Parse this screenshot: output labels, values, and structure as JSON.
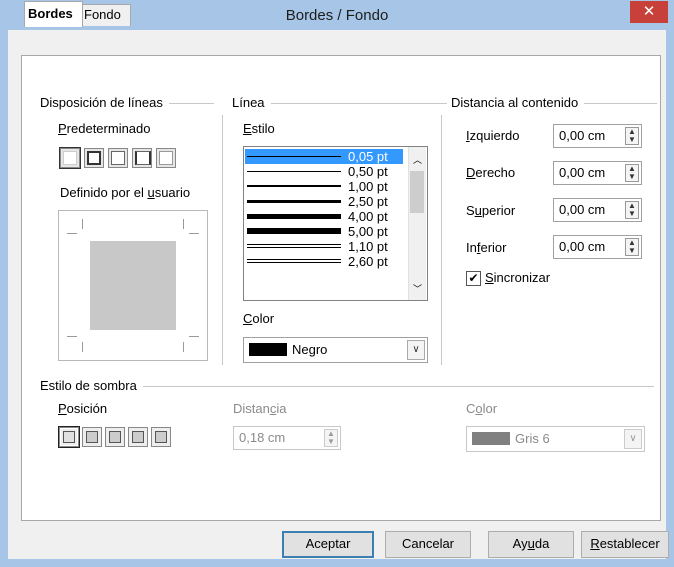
{
  "window": {
    "title": "Bordes / Fondo",
    "close_glyph": "✕"
  },
  "tabs": [
    {
      "label": "Bordes"
    },
    {
      "label": "Fondo"
    }
  ],
  "line_arrangement": {
    "group_title": "Disposición de líneas",
    "default_label": "Predeterminado",
    "user_defined_label": "Definido por el usuario",
    "preset_count": 5
  },
  "line": {
    "group_title": "Línea",
    "style_label": "Estilo",
    "styles": [
      {
        "label": "0,05 pt",
        "thickness": 1,
        "double": false,
        "selected": true
      },
      {
        "label": "0,50 pt",
        "thickness": 1,
        "double": false,
        "selected": false
      },
      {
        "label": "1,00 pt",
        "thickness": 2,
        "double": false,
        "selected": false
      },
      {
        "label": "2,50 pt",
        "thickness": 3,
        "double": false,
        "selected": false
      },
      {
        "label": "4,00 pt",
        "thickness": 5,
        "double": false,
        "selected": false
      },
      {
        "label": "5,00 pt",
        "thickness": 6,
        "double": false,
        "selected": false
      },
      {
        "label": "1,10 pt",
        "thickness": 1,
        "double": true,
        "selected": false
      },
      {
        "label": "2,60 pt",
        "thickness": 1,
        "double": true,
        "selected": false
      }
    ],
    "color_label": "Color",
    "color_value": "Negro",
    "color_swatch": "#000000"
  },
  "spacing": {
    "group_title": "Distancia al contenido",
    "fields": [
      {
        "label": "Izquierdo",
        "value": "0,00 cm"
      },
      {
        "label": "Derecho",
        "value": "0,00 cm"
      },
      {
        "label": "Superior",
        "value": "0,00 cm"
      },
      {
        "label": "Inferior",
        "value": "0,00 cm"
      }
    ],
    "sync_label": "Sincronizar",
    "sync_checked": true
  },
  "shadow": {
    "group_title": "Estilo de sombra",
    "position_label": "Posición",
    "distance_label": "Distancia",
    "distance_value": "0,18 cm",
    "color_label": "Color",
    "color_value": "Gris 6",
    "color_swatch": "#808080"
  },
  "buttons": {
    "ok": "Aceptar",
    "cancel": "Cancelar",
    "help": "Ayuda",
    "reset": "Restablecer"
  }
}
